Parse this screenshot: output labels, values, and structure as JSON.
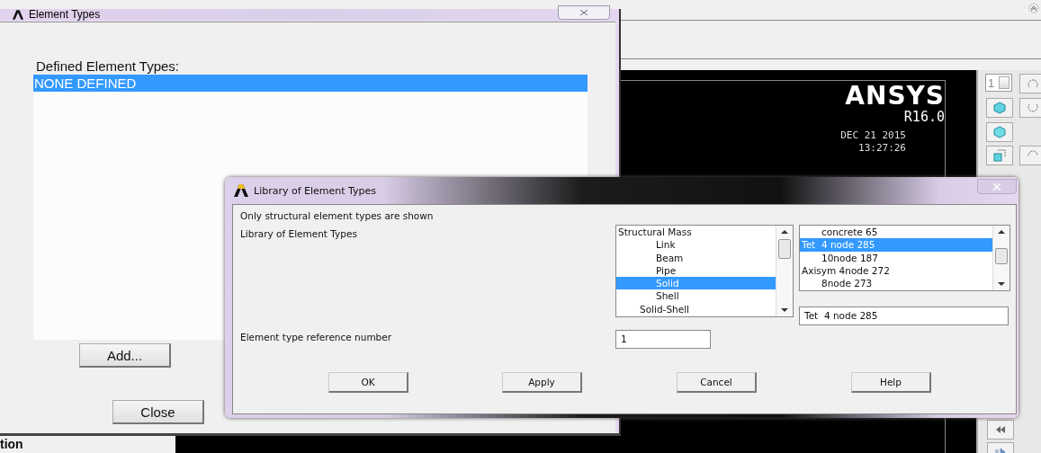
{
  "main_window": {
    "graphics": {
      "logo": "ANSYS",
      "version": "R16.0",
      "date": "DEC 21 2015",
      "time": "13:27:26"
    },
    "toolbar": {
      "view_number": "1"
    },
    "panel_label": "tion"
  },
  "element_types_window": {
    "title": "Element Types",
    "list_label": "Defined Element Types:",
    "items": [
      {
        "label": "NONE DEFINED",
        "selected": true
      }
    ],
    "buttons": [
      "Add...",
      "Close"
    ]
  },
  "library_dialog": {
    "title": "Library of Element Types",
    "note": "Only structural element types are shown",
    "library_label": "Library of Element Types",
    "ref_label": "Element type reference number",
    "categories": [
      {
        "label": "Structural Mass",
        "kind": "top",
        "selected": false
      },
      {
        "label": "Link",
        "kind": "sub",
        "selected": false
      },
      {
        "label": "Beam",
        "kind": "sub",
        "selected": false
      },
      {
        "label": "Pipe",
        "kind": "sub",
        "selected": false
      },
      {
        "label": "Solid",
        "kind": "sub",
        "selected": true
      },
      {
        "label": "Shell",
        "kind": "sub",
        "selected": false
      },
      {
        "label": "Solid-Shell",
        "kind": "mid",
        "selected": false
      }
    ],
    "types": [
      {
        "label": "concrete 65",
        "kind": "sub",
        "selected": false
      },
      {
        "label": "Tet  4 node 285",
        "kind": "top",
        "selected": true
      },
      {
        "label": "10node 187",
        "kind": "sub",
        "selected": false
      },
      {
        "label": "Axisym 4node 272",
        "kind": "top",
        "selected": false
      },
      {
        "label": "8node 273",
        "kind": "sub",
        "selected": false
      }
    ],
    "selected_type": "Tet  4 node 285",
    "ref_number": "1",
    "buttons": [
      "OK",
      "Apply",
      "Cancel",
      "Help"
    ]
  }
}
